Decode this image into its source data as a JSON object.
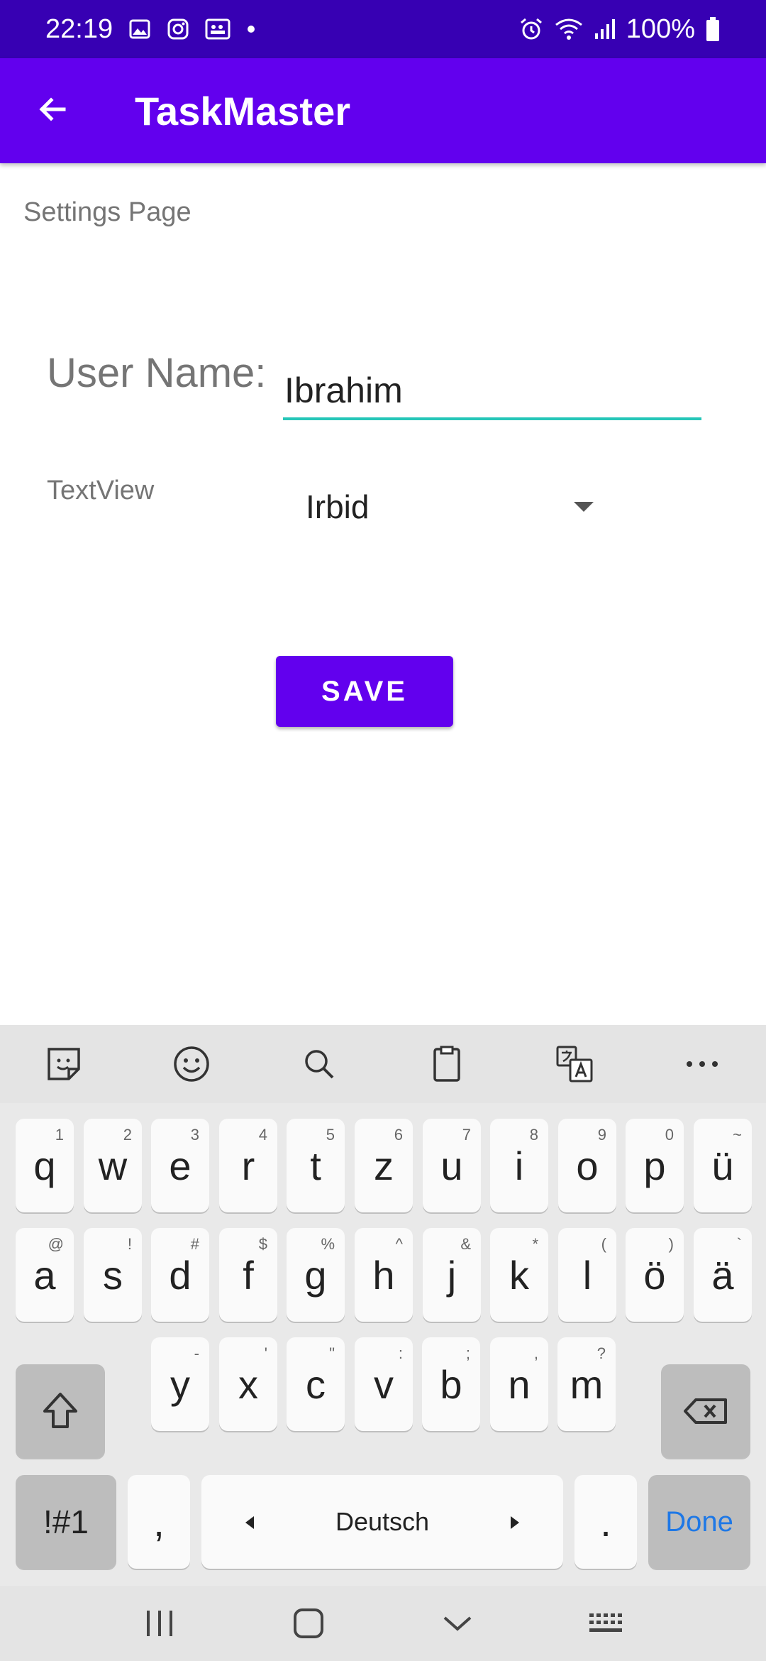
{
  "status_bar": {
    "time": "22:19",
    "battery": "100%",
    "left_icons": [
      "image-icon",
      "instagram-icon",
      "teams-icon",
      "dot-icon"
    ],
    "right_icons": [
      "alarm-icon",
      "wifi-icon",
      "signal-icon",
      "battery-icon"
    ]
  },
  "app_bar": {
    "title": "TaskMaster",
    "back_icon": "arrow-back-icon",
    "background": "#6200EE"
  },
  "content": {
    "page_label": "Settings Page",
    "user_name_label": "User Name:",
    "user_name_value": "Ibrahim",
    "textview_label": "TextView",
    "city_selected": "Irbid",
    "save_label": "SAVE",
    "accent": "#6200EE",
    "input_underline": "#26C6B8"
  },
  "keyboard": {
    "toolbar": [
      "sticker-icon",
      "emoji-icon",
      "search-icon",
      "clipboard-icon",
      "translate-icon",
      "more-icon"
    ],
    "row1": [
      {
        "k": "q",
        "h": "1"
      },
      {
        "k": "w",
        "h": "2"
      },
      {
        "k": "e",
        "h": "3"
      },
      {
        "k": "r",
        "h": "4"
      },
      {
        "k": "t",
        "h": "5"
      },
      {
        "k": "z",
        "h": "6"
      },
      {
        "k": "u",
        "h": "7"
      },
      {
        "k": "i",
        "h": "8"
      },
      {
        "k": "o",
        "h": "9"
      },
      {
        "k": "p",
        "h": "0"
      },
      {
        "k": "ü",
        "h": "~"
      }
    ],
    "row2": [
      {
        "k": "a",
        "h": "@"
      },
      {
        "k": "s",
        "h": "!"
      },
      {
        "k": "d",
        "h": "#"
      },
      {
        "k": "f",
        "h": "$"
      },
      {
        "k": "g",
        "h": "%"
      },
      {
        "k": "h",
        "h": "^"
      },
      {
        "k": "j",
        "h": "&"
      },
      {
        "k": "k",
        "h": "*"
      },
      {
        "k": "l",
        "h": "("
      },
      {
        "k": "ö",
        "h": ")"
      },
      {
        "k": "ä",
        "h": "`"
      }
    ],
    "row3": [
      {
        "k": "y",
        "h": "-"
      },
      {
        "k": "x",
        "h": "'"
      },
      {
        "k": "c",
        "h": "\""
      },
      {
        "k": "v",
        "h": ":"
      },
      {
        "k": "b",
        "h": ";"
      },
      {
        "k": "n",
        "h": ","
      },
      {
        "k": "m",
        "h": "?"
      }
    ],
    "symbols_label": "!#1",
    "comma": ",",
    "space_label": "Deutsch",
    "period": ".",
    "done_label": "Done"
  },
  "nav_bar": [
    "recents-icon",
    "home-icon",
    "back-chevron-icon",
    "keyboard-icon"
  ]
}
